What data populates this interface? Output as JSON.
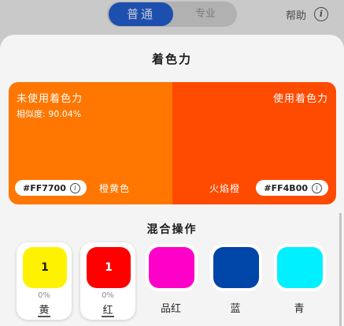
{
  "topbar": {
    "mode_normal": "普通",
    "mode_pro": "专业",
    "help_label": "帮助",
    "help_icon": "info-icon"
  },
  "sheet": {
    "title": "着色力",
    "compare": {
      "left": {
        "title": "未使用着色力",
        "similarity": "相似度: 90.04%",
        "hex": "#FF7700",
        "name": "橙黄色",
        "color": "#ff7700"
      },
      "right": {
        "title": "使用着色力",
        "hex": "#FF4B00",
        "name": "火焰橙",
        "color": "#ff4b00"
      }
    },
    "mix_title": "混合操作",
    "swatches": [
      {
        "label": "黄",
        "count": "1",
        "percent": "0%",
        "color": "#fff200"
      },
      {
        "label": "红",
        "count": "1",
        "percent": "0%",
        "color": "#ff0000"
      },
      {
        "label": "品红",
        "color": "#ff00c8"
      },
      {
        "label": "蓝",
        "color": "#0045a8"
      },
      {
        "label": "青",
        "color": "#00f0ff"
      }
    ]
  }
}
